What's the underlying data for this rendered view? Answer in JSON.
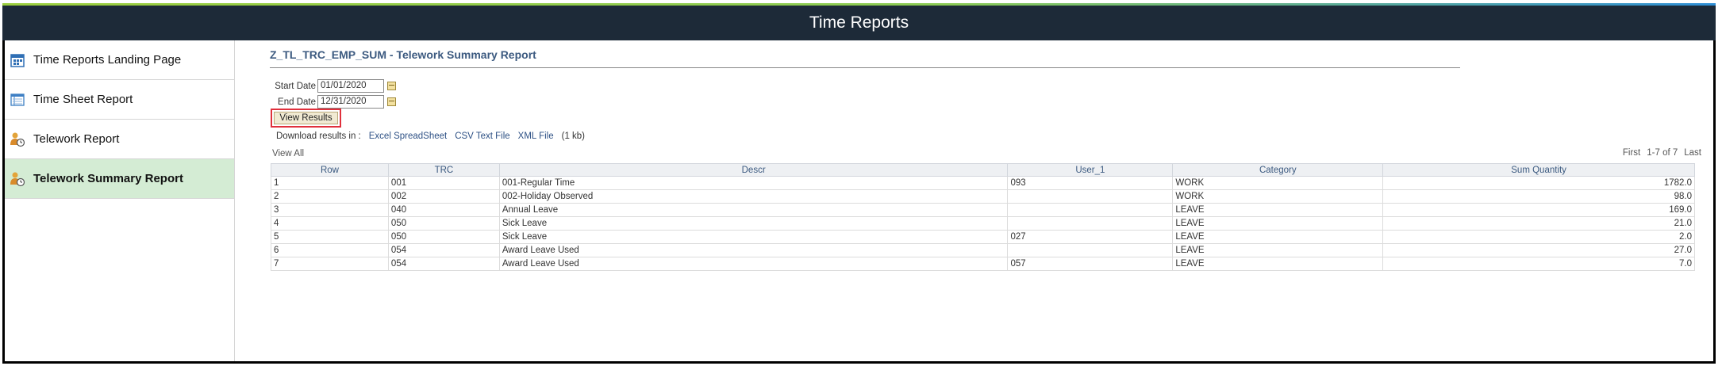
{
  "header": {
    "title": "Time Reports"
  },
  "sidebar": {
    "items": [
      {
        "label": "Time Reports Landing Page",
        "icon": "calendar-icon"
      },
      {
        "label": "Time Sheet Report",
        "icon": "timesheet-icon"
      },
      {
        "label": "Telework Report",
        "icon": "person-clock-icon"
      },
      {
        "label": "Telework Summary Report",
        "icon": "person-clock-icon",
        "active": true
      }
    ]
  },
  "report": {
    "title": "Z_TL_TRC_EMP_SUM - Telework Summary Report",
    "start_label": "Start Date",
    "start_value": "01/01/2020",
    "end_label": "End Date",
    "end_value": "12/31/2020",
    "view_button": "View Results",
    "download_label": "Download results in :",
    "excel_link": "Excel SpreadSheet",
    "csv_link": "CSV Text File",
    "xml_link": "XML File",
    "size": "(1 kb)",
    "view_all": "View All",
    "pager_first": "First",
    "pager_range": "1-7 of 7",
    "pager_last": "Last"
  },
  "table": {
    "columns": [
      "Row",
      "TRC",
      "Descr",
      "User_1",
      "Category",
      "Sum Quantity"
    ],
    "rows": [
      [
        "1",
        "001",
        "001-Regular Time",
        "093",
        "WORK",
        "1782.0"
      ],
      [
        "2",
        "002",
        "002-Holiday Observed",
        "",
        "WORK",
        "98.0"
      ],
      [
        "3",
        "040",
        "Annual Leave",
        "",
        "LEAVE",
        "169.0"
      ],
      [
        "4",
        "050",
        "Sick Leave",
        "",
        "LEAVE",
        "21.0"
      ],
      [
        "5",
        "050",
        "Sick Leave",
        "027",
        "LEAVE",
        "2.0"
      ],
      [
        "6",
        "054",
        "Award Leave Used",
        "",
        "LEAVE",
        "27.0"
      ],
      [
        "7",
        "054",
        "Award Leave Used",
        "057",
        "LEAVE",
        "7.0"
      ]
    ]
  },
  "colors": {
    "header_bg": "#1d2a38",
    "active_bg": "#d4ecd4",
    "link": "#2e5185",
    "title": "#3c5a80",
    "highlight": "#e0303c"
  }
}
